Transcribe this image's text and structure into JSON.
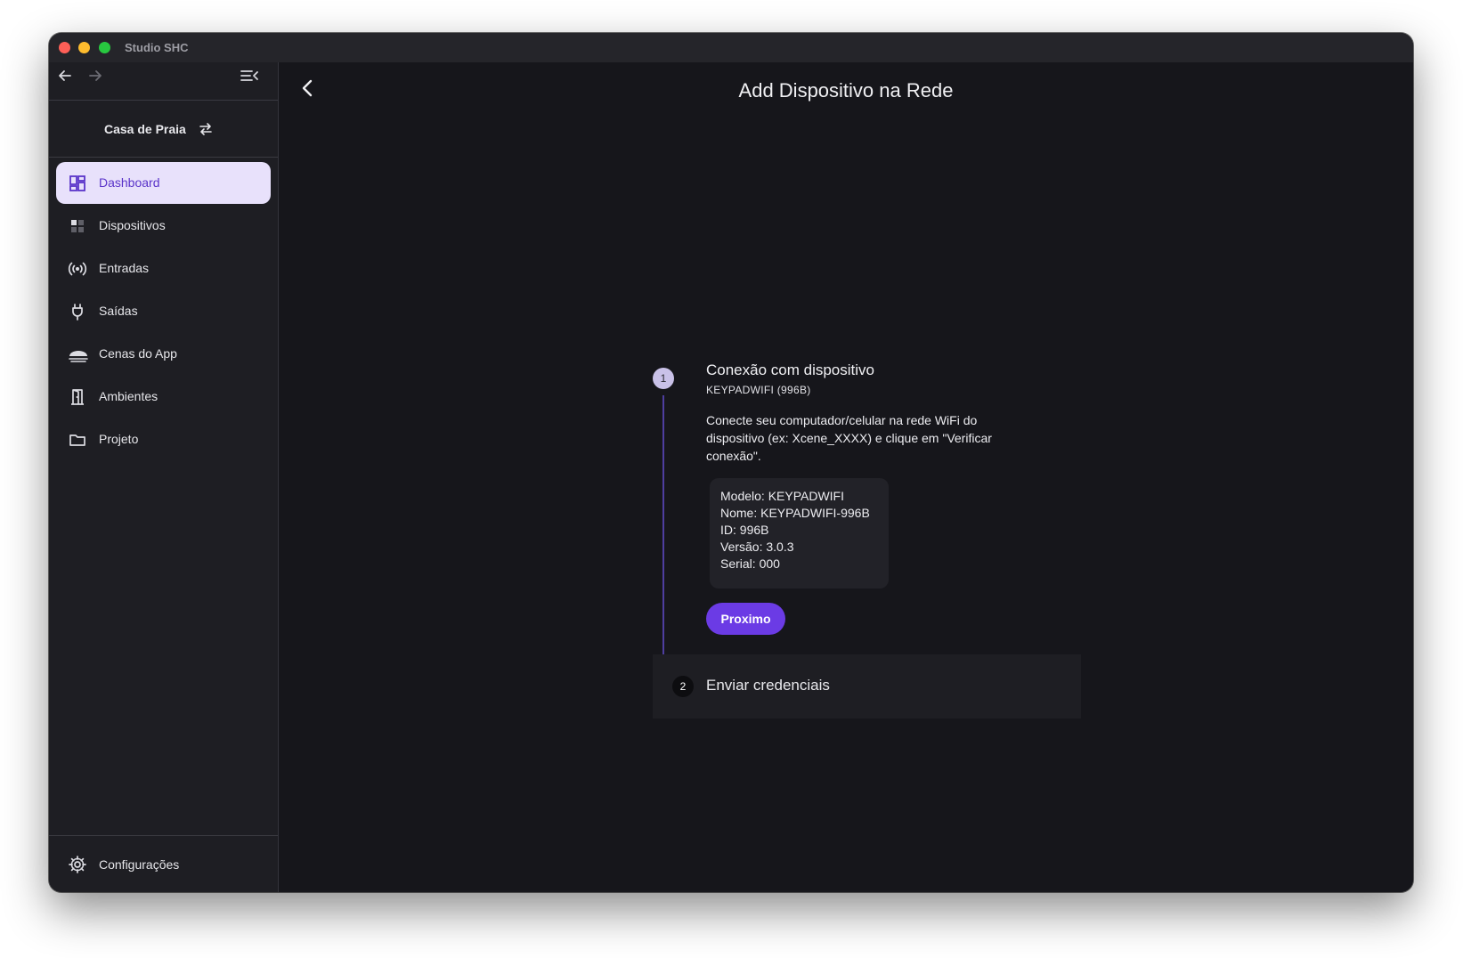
{
  "window": {
    "title": "Studio SHC"
  },
  "sidebar": {
    "project": "Casa de Praia",
    "items": [
      {
        "label": "Dashboard",
        "icon": "dashboard-icon",
        "active": true
      },
      {
        "label": "Dispositivos",
        "icon": "devices-icon"
      },
      {
        "label": "Entradas",
        "icon": "broadcast-icon"
      },
      {
        "label": "Saídas",
        "icon": "plug-icon"
      },
      {
        "label": "Cenas do App",
        "icon": "scene-icon"
      },
      {
        "label": "Ambientes",
        "icon": "door-icon"
      },
      {
        "label": "Projeto",
        "icon": "folder-icon"
      }
    ],
    "settings_label": "Configurações"
  },
  "main": {
    "title": "Add Dispositivo na Rede",
    "stepper": {
      "step1": {
        "number": "1",
        "title": "Conexão com dispositivo",
        "subtitle": "KEYPADWIFI (996B)",
        "description": "Conecte seu computador/celular na rede WiFi do dispositivo (ex: Xcene_XXXX) e clique em \"Verificar conexão\".",
        "info": [
          "Modelo: KEYPADWIFI",
          "Nome: KEYPADWIFI-996B",
          "ID: 996B",
          "Versão: 3.0.3",
          "Serial: 000"
        ],
        "button": "Proximo"
      },
      "step2": {
        "number": "2",
        "title": "Enviar credenciais"
      }
    }
  },
  "colors": {
    "accent": "#6b3be5",
    "active_bg": "#e8e1fb",
    "background": "#16161b"
  }
}
